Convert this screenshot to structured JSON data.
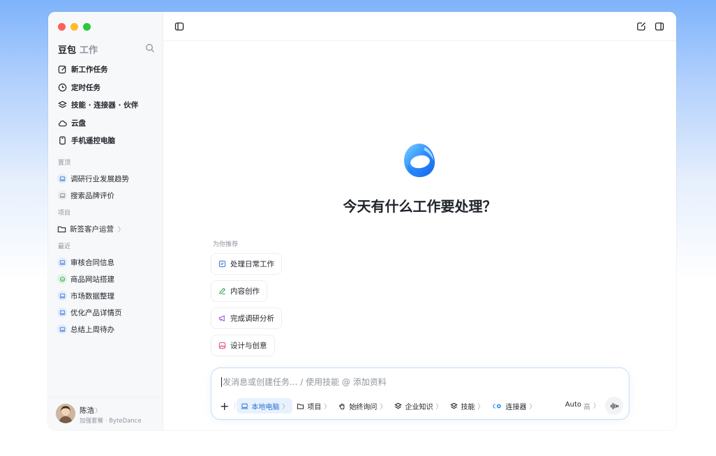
{
  "sidebar": {
    "brand": {
      "name": "豆包",
      "sub": "工作"
    },
    "nav": [
      {
        "label": "新工作任务",
        "icon": "edit-icon"
      },
      {
        "label": "定时任务",
        "icon": "clock-icon"
      },
      {
        "label": "技能 · 连接器 · 伙伴",
        "icon": "layers-icon"
      },
      {
        "label": "云盘",
        "icon": "cloud-icon"
      },
      {
        "label": "手机遥控电脑",
        "icon": "phone-icon"
      }
    ],
    "pinned_label": "置顶",
    "pinned": [
      {
        "label": "调研行业发展趋势"
      },
      {
        "label": "搜索品牌评价"
      }
    ],
    "projects_label": "项目",
    "projects": [
      {
        "label": "新签客户运营",
        "chevron": "〉"
      }
    ],
    "recent_label": "最近",
    "recent": [
      {
        "label": "审核合同信息"
      },
      {
        "label": "商品网站搭建"
      },
      {
        "label": "市场数据整理"
      },
      {
        "label": "优化产品详情页"
      },
      {
        "label": "总结上周待办"
      }
    ],
    "user": {
      "name": "陈浩",
      "chevron": "〉",
      "plan": "加强套餐 · ByteDance"
    }
  },
  "main": {
    "headline": "今天有什么工作要处理？",
    "recommend_label": "为你推荐",
    "recommendations": [
      {
        "label": "处理日常工作"
      },
      {
        "label": "内容创作"
      },
      {
        "label": "完成调研分析"
      },
      {
        "label": "设计与创意"
      }
    ],
    "composer": {
      "placeholder": "发消息或创建任务... / 使用技能 @ 添加资料",
      "plus": "+",
      "tools": [
        {
          "label": "本地电脑",
          "chevron": "〉"
        },
        {
          "label": "项目",
          "chevron": "〉"
        },
        {
          "label": "始终询问",
          "chevron": "〉"
        },
        {
          "label": "企业知识",
          "chevron": "〉"
        },
        {
          "label": "技能",
          "chevron": "〉"
        },
        {
          "label": "连接器",
          "chevron": "〉"
        }
      ],
      "mode": {
        "label": "Auto",
        "level": "高",
        "chevron": "〉"
      }
    }
  },
  "colors": {
    "accent": "#2a6fd6",
    "background_top": "#7eb3fb"
  }
}
